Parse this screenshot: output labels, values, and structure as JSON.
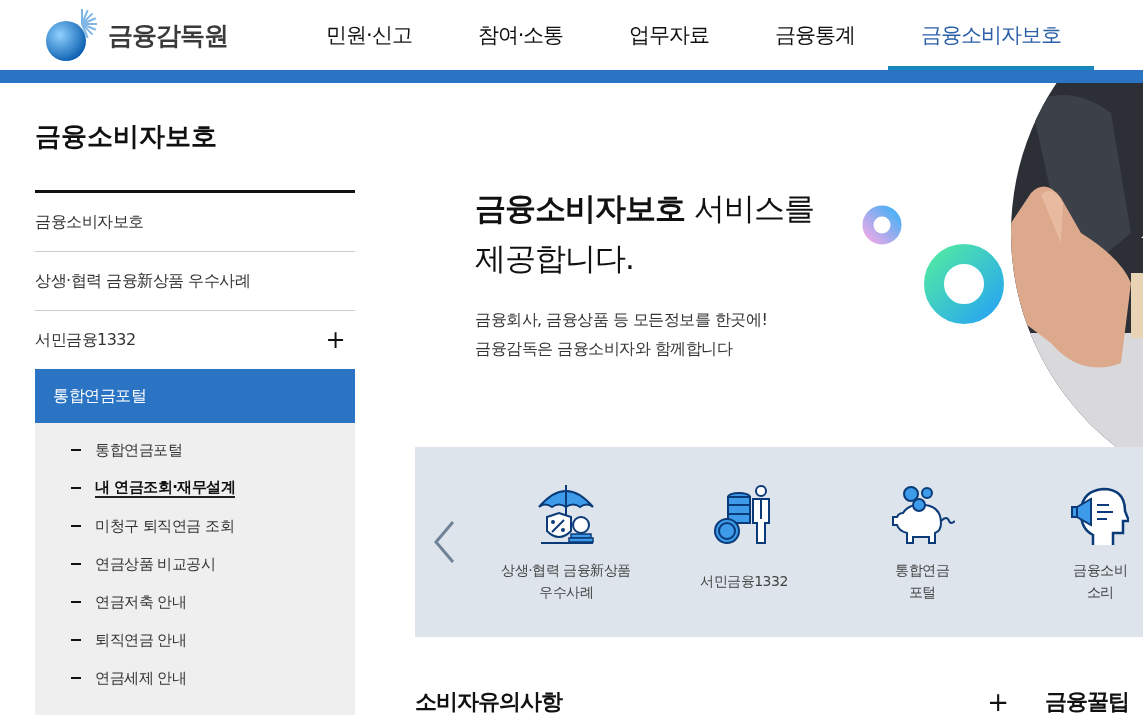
{
  "header": {
    "logo_text": "금융감독원",
    "nav": [
      {
        "label": "민원·신고",
        "selected": false
      },
      {
        "label": "참여·소통",
        "selected": false
      },
      {
        "label": "업무자료",
        "selected": false
      },
      {
        "label": "금융통계",
        "selected": false
      },
      {
        "label": "금융소비자보호",
        "selected": true
      }
    ]
  },
  "sidebar": {
    "title": "금융소비자보호",
    "items": [
      {
        "label": "금융소비자보호",
        "expanded": false
      },
      {
        "label": "상생·협력 금융新상품 우수사례",
        "expanded": false
      },
      {
        "label": "서민금융1332",
        "expanded": false,
        "toggle": "+"
      },
      {
        "label": "통합연금포털",
        "expanded": true,
        "children": [
          {
            "label": "통합연금포털",
            "selected": false
          },
          {
            "label": "내 연금조회·재무설계",
            "selected": true
          },
          {
            "label": "미청구 퇴직연금 조회",
            "selected": false
          },
          {
            "label": "연금상품 비교공시",
            "selected": false
          },
          {
            "label": "연금저축 안내",
            "selected": false
          },
          {
            "label": "퇴직연금 안내",
            "selected": false
          },
          {
            "label": "연금세제 안내",
            "selected": false
          }
        ]
      }
    ]
  },
  "hero": {
    "title_lines": [
      "**금융소비자보호** 서비스를",
      "제공합니다."
    ],
    "lines": [
      "금융회사, 금융상품 등 모든정보를 한곳에!",
      "금융감독은 금융소비자와 함께합니다"
    ]
  },
  "quick_links": {
    "items": [
      {
        "kind": "umbrella",
        "label_lines": [
          "상생·협력 금융新상품",
          "우수사례"
        ]
      },
      {
        "kind": "coins",
        "label_lines": [
          "서민금융1332"
        ]
      },
      {
        "kind": "piggy",
        "label_lines": [
          "통합연금",
          "포털"
        ]
      },
      {
        "kind": "head",
        "label_lines": [
          "금융소비",
          "소리"
        ]
      }
    ]
  },
  "sections": [
    {
      "title": "소비자유의사항",
      "more": "+"
    },
    {
      "title": "금융꿀팁"
    }
  ]
}
